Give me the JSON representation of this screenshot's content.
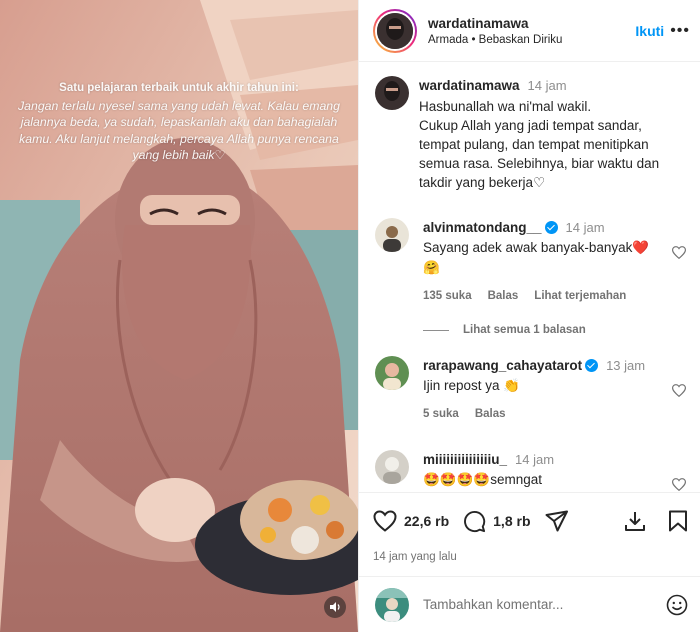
{
  "post": {
    "overlay_title": "Satu pelajaran terbaik untuk akhir tahun ini:",
    "overlay_body": "Jangan terlalu nyesel sama yang udah lewat. Kalau emang jalannya beda, ya sudah, lepaskanlah aku dan bahagialah kamu. Aku lanjut melangkah, percaya Allah punya rencana yang lebih baik♡"
  },
  "header": {
    "username": "wardatinamawa",
    "subline": "Armada • Bebaskan Diriku",
    "follow_label": "Ikuti",
    "more_label": "•••"
  },
  "caption": {
    "username": "wardatinamawa",
    "time": "14 jam",
    "text": "Hasbunallah wa ni'mal wakil.\nCukup Allah yang jadi tempat sandar, tempat pulang, dan tempat menitipkan semua rasa. Selebihnya, biar waktu dan takdir yang bekerja♡"
  },
  "comments": [
    {
      "username": "alvinmatondang__",
      "verified": true,
      "time": "14 jam",
      "text": "Sayang adek awak banyak-banyak❤️🤗",
      "likes": "135 suka",
      "reply_label": "Balas",
      "translate_label": "Lihat terjemahan",
      "view_replies": "Lihat semua 1 balasan"
    },
    {
      "username": "rarapawang_cahayatarot",
      "verified": true,
      "time": "13 jam",
      "text": "Ijin repost ya 👏",
      "likes": "5 suka",
      "reply_label": "Balas"
    },
    {
      "username": "miiiiiiiiiiiiiiiu_",
      "verified": false,
      "time": "14 jam",
      "text": "🤩🤩🤩🤩semngat"
    }
  ],
  "actions": {
    "likes_count": "22,6 rb",
    "comments_count": "1,8 rb",
    "posted_time": "14 jam yang lalu"
  },
  "add_comment": {
    "placeholder": "Tambahkan komentar..."
  },
  "colors": {
    "accent": "#0095f6",
    "text": "#262626",
    "muted": "#737373",
    "divider": "#efefef"
  },
  "icons": {
    "like": "heart-icon",
    "comment": "comment-bubble-icon",
    "share": "paper-plane-icon",
    "download": "download-icon",
    "save": "bookmark-icon",
    "mute": "speaker-icon",
    "emoji": "smiley-icon"
  }
}
